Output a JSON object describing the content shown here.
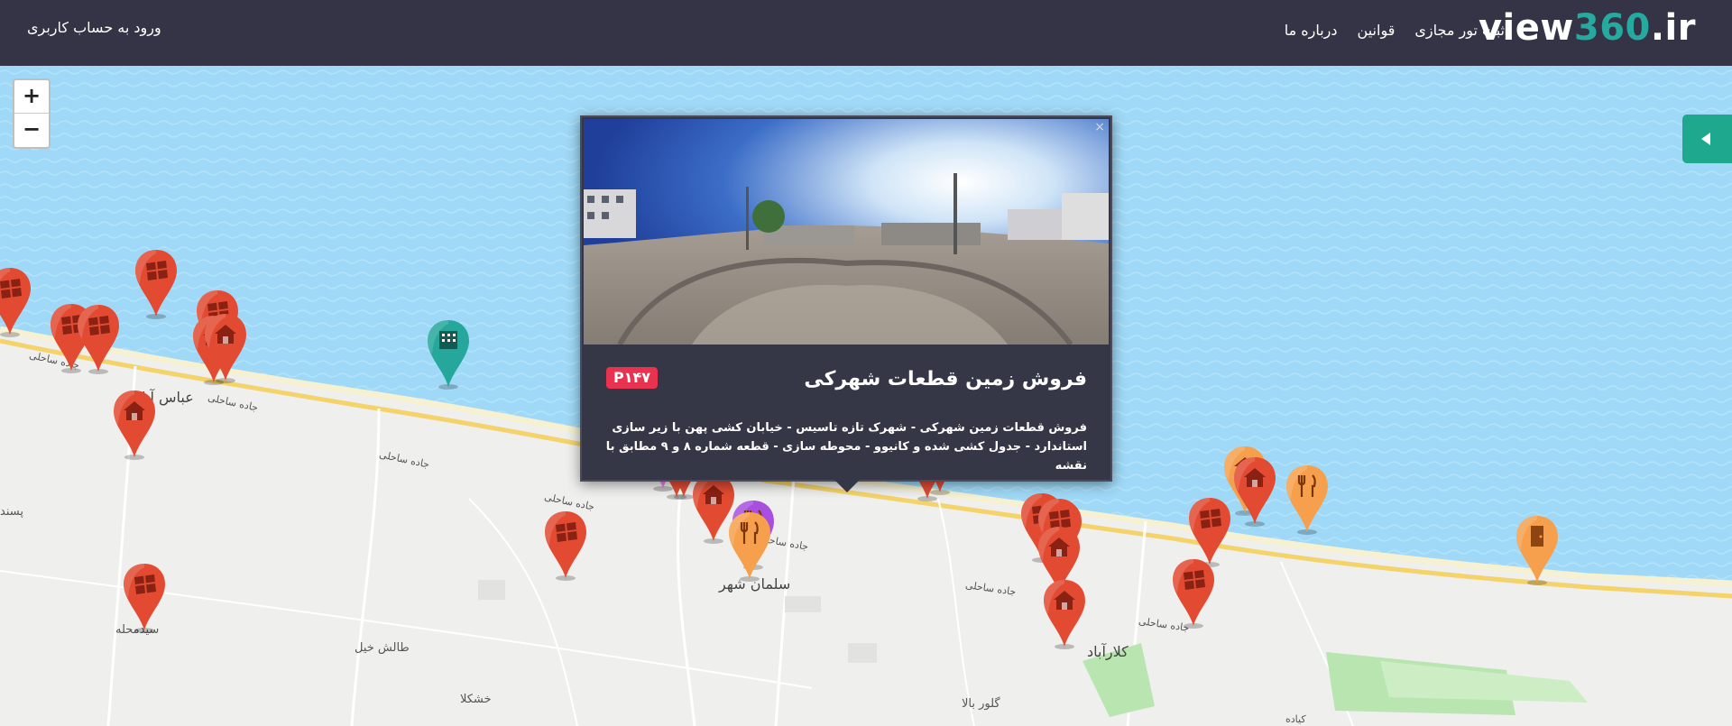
{
  "header": {
    "logo_main": "view",
    "logo_number": "360",
    "logo_tld": ".ir",
    "nav": [
      {
        "label": "ثبت تور مجازی"
      },
      {
        "label": "قوانین"
      },
      {
        "label": "درباره ما"
      }
    ],
    "login_label": "ورود به حساب کاربری"
  },
  "map": {
    "zoom_in": "+",
    "zoom_out": "−",
    "places": [
      {
        "label": "عباس آباد"
      },
      {
        "label": "سلمان شهر"
      },
      {
        "label": "سیدمحله"
      },
      {
        "label": "طالش خیل"
      },
      {
        "label": "خشکلا"
      },
      {
        "label": "کلارآباد"
      },
      {
        "label": "گلور بالا"
      },
      {
        "label": "پسند"
      },
      {
        "label": "کیاده"
      }
    ],
    "road_label": "جاده ساحلی"
  },
  "popup": {
    "close": "×",
    "title": "فروش زمین قطعات شهرکی",
    "badge": "P۱۴۷",
    "description": "فروش قطعات زمین شهرکی - شهرک تازه تاسیس - خیابان کشی پهن با زیر سازی استاندارد - جدول کشی شده و کانیوو - محوطه سازی - قطعه شماره ۸ و ۹ مطابق با نقشه"
  },
  "colors": {
    "header_bg": "#343446",
    "logo_accent": "#26a99f",
    "sea": "#9fd9f7",
    "land": "#efefed",
    "marker_red": "#e24b32",
    "marker_orange": "#f6a04d",
    "marker_pink": "#ee7ee8",
    "marker_teal": "#26a79b",
    "marker_purple": "#a84fe0",
    "badge": "#e8324f",
    "side_toggle": "#1ea88e"
  },
  "markers": [
    {
      "type": "red",
      "icon": "land-icon"
    },
    {
      "type": "red",
      "icon": "land-icon"
    },
    {
      "type": "red",
      "icon": "land-icon"
    },
    {
      "type": "red",
      "icon": "land-icon"
    },
    {
      "type": "red",
      "icon": "land-icon"
    },
    {
      "type": "red",
      "icon": "house-icon"
    },
    {
      "type": "red",
      "icon": "house-icon"
    },
    {
      "type": "teal",
      "icon": "building-icon"
    },
    {
      "type": "orange",
      "icon": "restaurant-icon"
    },
    {
      "type": "teal",
      "icon": "building-icon"
    },
    {
      "type": "orange",
      "icon": "restaurant-icon"
    },
    {
      "type": "pink",
      "icon": "house-icon"
    },
    {
      "type": "red",
      "icon": "land-icon"
    },
    {
      "type": "pink",
      "icon": "house-icon"
    },
    {
      "type": "red",
      "icon": "house-icon"
    },
    {
      "type": "red",
      "icon": "house-icon"
    },
    {
      "type": "purple",
      "icon": "restaurant-icon"
    },
    {
      "type": "orange",
      "icon": "restaurant-icon"
    },
    {
      "type": "red",
      "icon": "house-icon"
    },
    {
      "type": "red",
      "icon": "house-icon"
    },
    {
      "type": "red",
      "icon": "house-icon"
    },
    {
      "type": "red",
      "icon": "land-icon"
    },
    {
      "type": "red",
      "icon": "land-icon"
    },
    {
      "type": "red",
      "icon": "land-icon"
    },
    {
      "type": "red",
      "icon": "house-icon"
    },
    {
      "type": "red",
      "icon": "house-icon"
    },
    {
      "type": "red",
      "icon": "land-icon"
    },
    {
      "type": "orange",
      "icon": "house-icon"
    },
    {
      "type": "red",
      "icon": "house-icon"
    },
    {
      "type": "orange",
      "icon": "restaurant-icon"
    },
    {
      "type": "red",
      "icon": "land-icon"
    },
    {
      "type": "orange",
      "icon": "door-icon"
    },
    {
      "type": "red",
      "icon": "land-icon"
    },
    {
      "type": "red",
      "icon": "land-icon"
    },
    {
      "type": "red",
      "icon": "house-icon"
    }
  ]
}
